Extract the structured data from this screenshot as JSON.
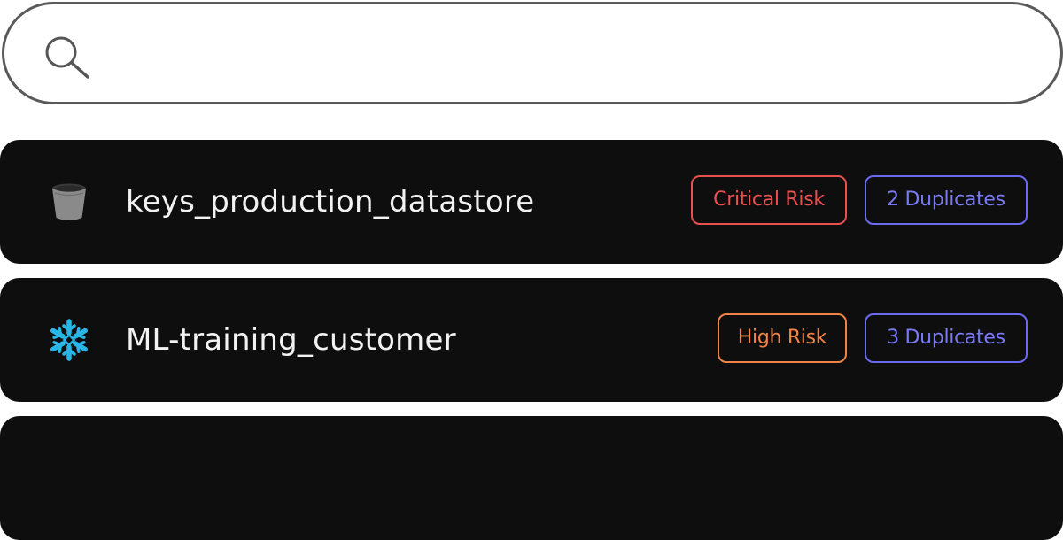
{
  "search": {
    "value": "",
    "placeholder": ""
  },
  "items": [
    {
      "name": "keys_production_datastore",
      "icon": "bucket-icon",
      "risk": "Critical Risk",
      "duplicates": "2 Duplicates"
    },
    {
      "name": "ML-training_customer",
      "icon": "snowflake-icon",
      "risk": "High Risk",
      "duplicates": "3 Duplicates"
    }
  ],
  "colors": {
    "critical": "#e8514f",
    "high": "#f08446",
    "duplicates": "#6a6af0",
    "row_bg": "#0e0e0e",
    "snowflake": "#29b5e8"
  }
}
